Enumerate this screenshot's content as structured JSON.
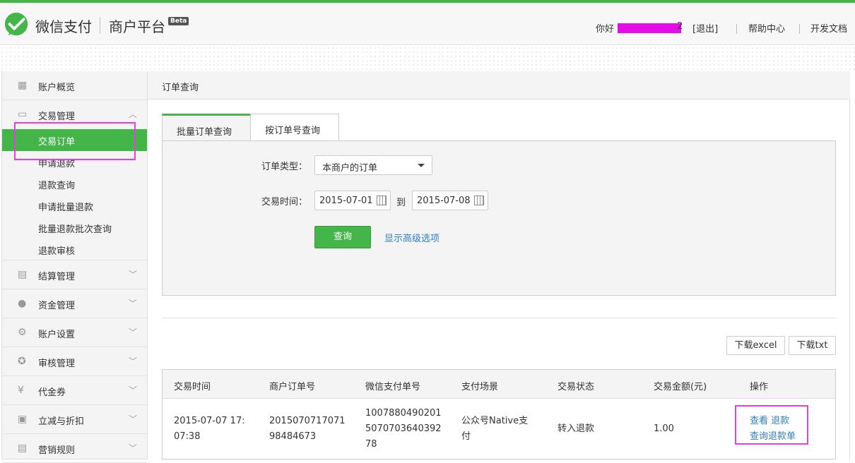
{
  "header": {
    "brand": "微信支付",
    "platform": "商户平台",
    "beta": "Beta",
    "greeting": "你好",
    "username_tail": "2",
    "logout": "[退出]",
    "help": "帮助中心",
    "devdoc": "开发文档"
  },
  "sidebar": {
    "overview": "账户概览",
    "trade": "交易管理",
    "trade_items": [
      "交易订单",
      "申请退款",
      "退款查询",
      "申请批量退款",
      "批量退款批次查询",
      "退款审核"
    ],
    "settlement": "结算管理",
    "funds": "资金管理",
    "account": "账户设置",
    "audit": "审核管理",
    "voucher": "代金券",
    "discount": "立减与折扣",
    "marketing": "营销规则"
  },
  "main": {
    "title": "订单查询",
    "tabs": [
      "批量订单查询",
      "按订单号查询"
    ],
    "form": {
      "type_label": "订单类型：",
      "type_value": "本商户的订单",
      "time_label": "交易时间：",
      "start_date": "2015-07-01",
      "to": "到",
      "end_date": "2015-07-08",
      "query_button": "查询",
      "advanced_link": "显示高级选项"
    },
    "downloads": {
      "excel": "下载excel",
      "txt": "下载txt"
    },
    "table": {
      "headers": [
        "交易时间",
        "商户订单号",
        "微信支付单号",
        "支付场景",
        "交易状态",
        "交易金额(元)",
        "操作"
      ],
      "rows": [
        {
          "time_1": "2015-07-07 17:",
          "time_2": "07:38",
          "order_1": "2015070717071",
          "order_2": "98484673",
          "wx_1": "1007880490201",
          "wx_2": "5070703640392",
          "wx_3": "78",
          "scene_1": "公众号Native支",
          "scene_2": "付",
          "status": "转入退款",
          "amount": "1.00",
          "op_view": "查看",
          "op_refund": "退款",
          "op_query_refund": "查询退款单"
        }
      ]
    }
  },
  "colors": {
    "accent": "#44b549",
    "link": "#2e7fc3",
    "highlight": "#e53fe3"
  }
}
